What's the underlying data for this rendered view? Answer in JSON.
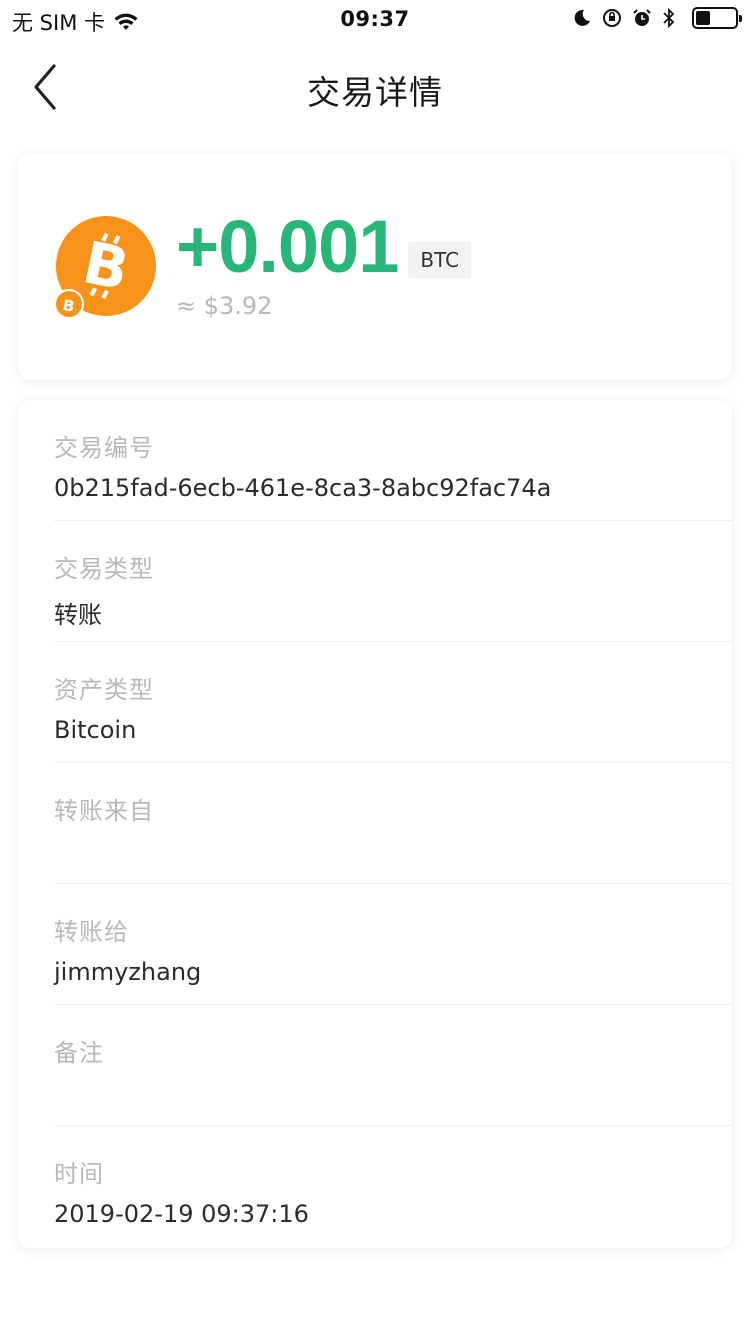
{
  "status_bar": {
    "carrier": "无 SIM 卡",
    "time": "09:37",
    "icons": [
      "wifi-icon",
      "moon-icon",
      "orientation-lock-icon",
      "alarm-icon",
      "bluetooth-icon",
      "battery-icon"
    ]
  },
  "nav": {
    "title": "交易详情",
    "back_icon": "chevron-left-icon"
  },
  "summary": {
    "amount": "+0.001",
    "unit": "BTC",
    "fiat": "≈ $3.92",
    "coin_icon": "bitcoin-icon",
    "colors": {
      "amount": "#27b677",
      "coin": "#f7931a"
    }
  },
  "details": [
    {
      "label": "交易编号",
      "value": "0b215fad-6ecb-461e-8ca3-8abc92fac74a"
    },
    {
      "label": "交易类型",
      "value": "转账"
    },
    {
      "label": "资产类型",
      "value": "Bitcoin"
    },
    {
      "label": "转账来自",
      "value": ""
    },
    {
      "label": "转账给",
      "value": "jimmyzhang"
    },
    {
      "label": "备注",
      "value": ""
    },
    {
      "label": "时间",
      "value": "2019-02-19 09:37:16"
    }
  ]
}
